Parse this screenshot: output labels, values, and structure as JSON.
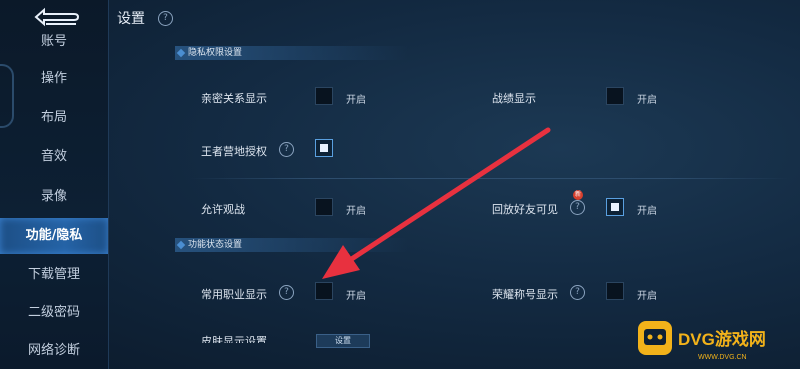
{
  "sidebar": {
    "partial_top": "账号",
    "items": [
      "操作",
      "布局",
      "音效",
      "录像",
      "功能/隐私",
      "下载管理",
      "二级密码",
      "网络诊断"
    ],
    "active_index": 4
  },
  "header": {
    "title": "设置",
    "help": "?"
  },
  "privacy": {
    "section_title": "隐私权限设置",
    "rows": [
      {
        "label": "亲密关系显示",
        "option": "开启",
        "checked": false
      },
      {
        "label": "战绩显示",
        "option": "开启",
        "checked": false
      },
      {
        "label": "王者营地授权",
        "checked": true
      },
      {
        "label": "允许观战",
        "option": "开启",
        "checked": false
      },
      {
        "label": "回放好友可见",
        "option": "开启",
        "checked": true,
        "badge": "新"
      }
    ]
  },
  "function": {
    "section_title": "功能状态设置",
    "rows": [
      {
        "label": "常用职业显示",
        "option": "开启",
        "checked": false
      },
      {
        "label": "荣耀称号显示",
        "option": "开启",
        "checked": false
      },
      {
        "label": "皮肤显示设置",
        "button": "设置"
      }
    ]
  },
  "watermark": {
    "brand": "DVG游戏网",
    "url": "WWW.DVG.CN"
  },
  "colors": {
    "accent": "#2563a6",
    "arrow": "#e8313f",
    "watermark": "#f2b21a"
  }
}
